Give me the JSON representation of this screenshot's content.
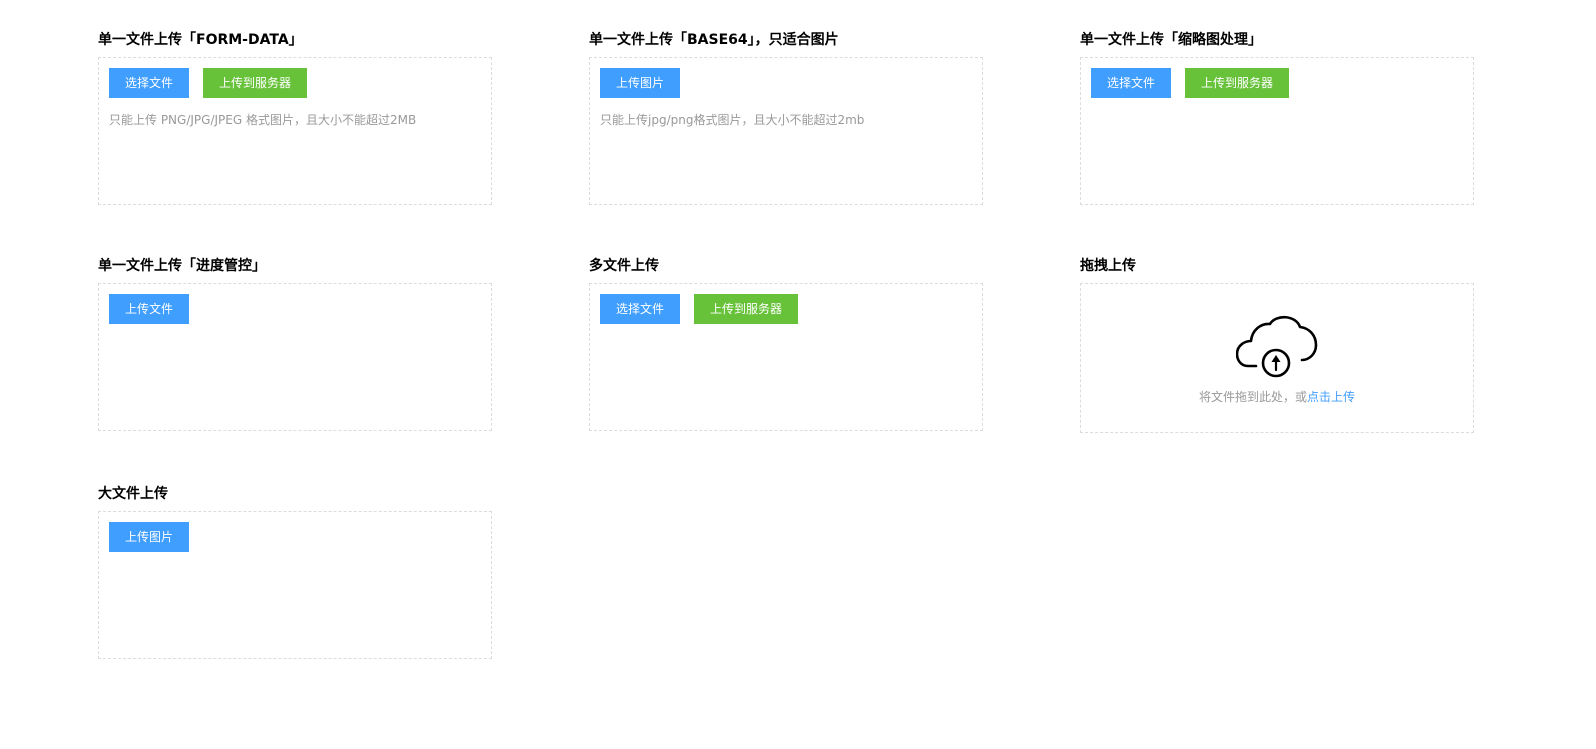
{
  "sections": [
    {
      "title": "单一文件上传「FORM-DATA」",
      "buttons": [
        "选择文件",
        "上传到服务器"
      ],
      "tip": "只能上传 PNG/JPG/JPEG 格式图片，且大小不能超过2MB"
    },
    {
      "title": "单一文件上传「BASE64」，只适合图片",
      "buttons": [
        "上传图片"
      ],
      "tip": "只能上传jpg/png格式图片，且大小不能超过2mb"
    },
    {
      "title": "单一文件上传「缩略图处理」",
      "buttons": [
        "选择文件",
        "上传到服务器"
      ]
    },
    {
      "title": "单一文件上传「进度管控」",
      "buttons": [
        "上传文件"
      ]
    },
    {
      "title": "多文件上传",
      "buttons": [
        "选择文件",
        "上传到服务器"
      ]
    },
    {
      "title": "拖拽上传",
      "drag_text": "将文件拖到此处，或",
      "drag_link": "点击上传",
      "icon": "cloud-upload-icon"
    },
    {
      "title": "大文件上传",
      "buttons": [
        "上传图片"
      ]
    }
  ],
  "colors": {
    "primary": "#409eff",
    "success": "#67c23a",
    "border": "#dcdcdc",
    "tip": "#999999"
  }
}
